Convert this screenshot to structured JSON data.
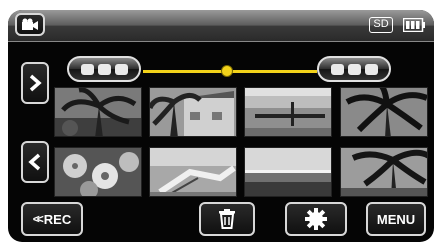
{
  "header": {
    "mode_icon": "video-camera-icon",
    "media_label": "SD",
    "battery_icon": "battery-icon"
  },
  "timeline": {
    "prev_group_icon": "three-dots-icon",
    "next_group_icon": "three-dots-icon",
    "date_label": "",
    "position": 0.48
  },
  "navigation": {
    "next_icon": "chevron-right-icon",
    "prev_icon": "chevron-left-icon"
  },
  "thumbnails": [
    {
      "scene": "palm-tree-silhouette"
    },
    {
      "scene": "building-and-palm"
    },
    {
      "scene": "pier-over-water"
    },
    {
      "scene": "palm-tree-silhouette"
    },
    {
      "scene": "flowers"
    },
    {
      "scene": "beach-chair"
    },
    {
      "scene": "sunset-over-sea"
    },
    {
      "scene": "palm-fronds"
    }
  ],
  "footer": {
    "rec_label": "REC",
    "rec_icon": "double-chevron-left-icon",
    "delete_icon": "trash-icon",
    "gear_icon": "gear-icon",
    "menu_label": "MENU"
  },
  "colors": {
    "timeline": "#f2d21a",
    "background": "#050505"
  }
}
